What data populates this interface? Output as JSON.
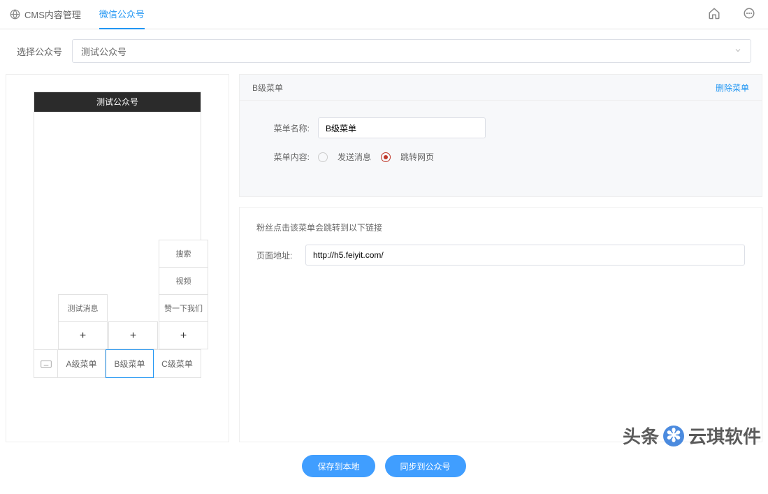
{
  "top": {
    "brand": "CMS内容管理",
    "tab": "微信公众号"
  },
  "selector": {
    "label": "选择公众号",
    "value": "测试公众号"
  },
  "phone": {
    "title": "测试公众号",
    "menu_a": "A级菜单",
    "menu_b": "B级菜单",
    "menu_c": "C级菜单",
    "col_a": {
      "items": [
        "测试消息"
      ]
    },
    "col_c": {
      "items": [
        "搜索",
        "视频",
        "赞一下我们"
      ]
    },
    "add": "+"
  },
  "editor": {
    "title": "B级菜单",
    "delete": "删除菜单",
    "name_label": "菜单名称:",
    "name_value": "B级菜单",
    "content_label": "菜单内容:",
    "radio_send": "发送消息",
    "radio_link": "跳转网页",
    "link_hint": "粉丝点击该菜单会跳转到以下链接",
    "addr_label": "页面地址:",
    "addr_value": "http://h5.feiyit.com/"
  },
  "footer": {
    "save": "保存到本地",
    "sync": "同步到公众号"
  },
  "watermark": {
    "left": "头条",
    "right": "云琪软件"
  }
}
